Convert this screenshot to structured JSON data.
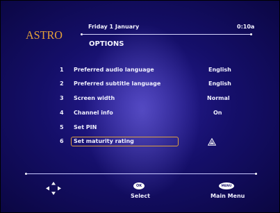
{
  "header": {
    "brand": "ASTRO",
    "date": "Friday 1 January",
    "time": "0:10a",
    "title": "OPTIONS"
  },
  "menu": {
    "items": [
      {
        "number": "1",
        "label": "Preferred audio language",
        "value": "English"
      },
      {
        "number": "2",
        "label": "Preferred subtitle language",
        "value": "English"
      },
      {
        "number": "3",
        "label": "Screen width",
        "value": "Normal"
      },
      {
        "number": "4",
        "label": "Channel info",
        "value": "On"
      },
      {
        "number": "5",
        "label": "Set PIN",
        "value": ""
      },
      {
        "number": "6",
        "label": "Set maturity rating",
        "value": "",
        "icon": "warning-icon",
        "selected": true
      }
    ]
  },
  "footer": {
    "ok_button": "OK",
    "ok_label": "Select",
    "menu_button": "MENU",
    "menu_label": "Main Menu",
    "nav_icon": "navigation-arrows-icon"
  },
  "colors": {
    "accent": "#e6a23a",
    "background": "#150f6a",
    "text": "#f0f0ff"
  }
}
